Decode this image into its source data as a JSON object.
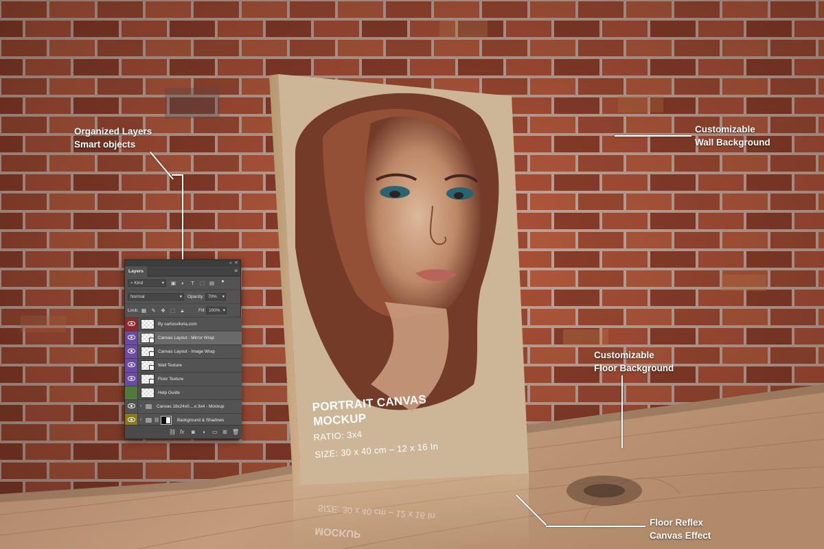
{
  "annotations": {
    "layers_title": "Organized Layers",
    "layers_subtitle": "Smart objects",
    "wall_title": "Customizable",
    "wall_subtitle": "Wall Background",
    "floor_title": "Customizable",
    "floor_subtitle": "Floor Background",
    "reflex_title": "Floor Reflex",
    "reflex_subtitle": "Canvas Effect"
  },
  "canvas": {
    "title_line1": "PORTRAIT CANVAS",
    "title_line2": "MOCKUP",
    "ratio": "RATIO: 3x4",
    "size": "SIZE: 30 x 40 cm – 12 x 16 In"
  },
  "layers_panel": {
    "tab": "Layers",
    "filter_kind": "Kind",
    "blend_mode": "Normal",
    "opacity_label": "Opacity:",
    "opacity_value": "70%",
    "lock_label": "Lock:",
    "fill_label": "Fill:",
    "fill_value": "100%",
    "layers": [
      {
        "name": "By carlosviloria.com",
        "eye": "#8f2a2a"
      },
      {
        "name": "Canvas Layout - Mirror Wrap",
        "eye": "#6b4aa8"
      },
      {
        "name": "Canvas Layout - Image Wrap",
        "eye": "#6b4aa8"
      },
      {
        "name": "Wall Texture",
        "eye": "#6b4aa8"
      },
      {
        "name": "Floor Texture",
        "eye": "#6b4aa8"
      },
      {
        "name": "Help Guide",
        "eye": "#4f7a3a"
      },
      {
        "name": "Canvas 18x24x0....o 3x4 - Mockup",
        "eye": "#535353"
      },
      {
        "name": "Background & Shadows",
        "eye": "#8a7a1a"
      }
    ]
  },
  "colors": {
    "brick": "#9c4a33",
    "mortar": "#c9a79a",
    "floor_wood": "#b89070",
    "canvas_bg": "#d8c0a2",
    "panel": "#535353",
    "annotation_text": "#ffffff"
  }
}
